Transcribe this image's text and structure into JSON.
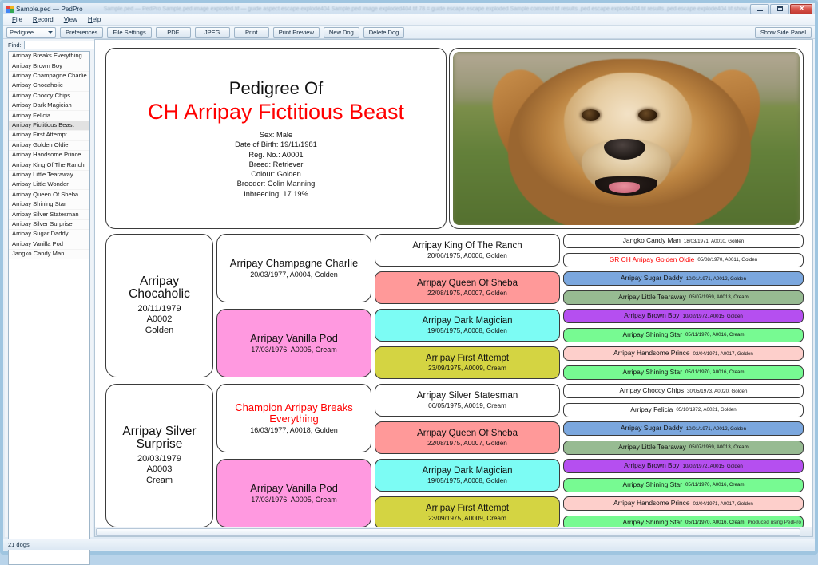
{
  "window": {
    "title": "Sample.ped — PedPro",
    "ghost_title": "Sample.ped — PedPro      Sample.ped image exploded.tif — guide aspect escape explode404      Sample.ped image exploded404 tif 78 = guide escape escape exploded      Sample comment      tif results .ped escape explode404      tif results .ped escape explode404      tif show escape escape ex",
    "minimize": "–",
    "maximize": "□",
    "close": "✕"
  },
  "menu": {
    "items": [
      "File",
      "Record",
      "View",
      "Help"
    ]
  },
  "toolbar": {
    "mode_combo": "Pedigree",
    "buttons": [
      "Preferences",
      "File Settings",
      "PDF",
      "JPEG",
      "Print",
      "Print Preview",
      "New Dog",
      "Delete Dog"
    ],
    "show_side_panel": "Show Side Panel"
  },
  "side_panel": {
    "find_label": "Find:",
    "find_value": "",
    "find_placeholder": "",
    "dogs": [
      {
        "name": "Arripay Breaks Everything",
        "selected": false
      },
      {
        "name": "Arripay Brown Boy",
        "selected": false
      },
      {
        "name": "Arripay Champagne Charlie",
        "selected": false
      },
      {
        "name": "Arripay Chocaholic",
        "selected": false
      },
      {
        "name": "Arripay Choccy Chips",
        "selected": false
      },
      {
        "name": "Arripay Dark Magician",
        "selected": false
      },
      {
        "name": "Arripay Felicia",
        "selected": false
      },
      {
        "name": "Arripay Fictitious Beast",
        "selected": true
      },
      {
        "name": "Arripay First Attempt",
        "selected": false
      },
      {
        "name": "Arripay Golden Oldie",
        "selected": false
      },
      {
        "name": "Arripay Handsome Prince",
        "selected": false
      },
      {
        "name": "Arripay King Of The Ranch",
        "selected": false
      },
      {
        "name": "Arripay Little Tearaway",
        "selected": false
      },
      {
        "name": "Arripay Little Wonder",
        "selected": false
      },
      {
        "name": "Arripay Queen Of Sheba",
        "selected": false
      },
      {
        "name": "Arripay Shining Star",
        "selected": false
      },
      {
        "name": "Arripay Silver Statesman",
        "selected": false
      },
      {
        "name": "Arripay Silver Surprise",
        "selected": false
      },
      {
        "name": "Arripay Sugar Daddy",
        "selected": false
      },
      {
        "name": "Arripay Vanilla Pod",
        "selected": false
      },
      {
        "name": "Jangko Candy Man",
        "selected": false
      }
    ]
  },
  "status_bar": {
    "text": "21 dogs"
  },
  "pedigree": {
    "heading": "Pedigree Of",
    "subject_name": "CH Arripay Fictitious Beast",
    "subject_name_color": "#ff0000",
    "details": [
      "Sex: Male",
      "Date of Birth: 19/11/1981",
      "Reg. No.: A0001",
      "Breed: Retriever",
      "Colour: Golden",
      "Breeder: Colin Manning",
      "Inbreeding: 17.19%"
    ],
    "photo_alt": "golden-retriever-photo",
    "footer": "Produced using PedPro",
    "generation1": [
      {
        "name_line1": "Arripay",
        "name_line2": "Chocaholic",
        "dob": "20/11/1979",
        "reg": "A0002",
        "colour": "Golden",
        "bg": "#ffffff",
        "champion": false
      },
      {
        "name_line1": "Arripay Silver",
        "name_line2": "Surprise",
        "dob": "20/03/1979",
        "reg": "A0003",
        "colour": "Cream",
        "bg": "#ffffff",
        "champion": false
      }
    ],
    "generation2": [
      {
        "name": "Arripay Champagne Charlie",
        "info": "20/03/1977, A0004, Golden",
        "bg": "#ffffff",
        "champion": false
      },
      {
        "name": "Arripay Vanilla Pod",
        "info": "17/03/1976, A0005, Cream",
        "bg": "#ff99e0",
        "champion": false
      },
      {
        "name": "Champion Arripay Breaks Everything",
        "info": "16/03/1977, A0018, Golden",
        "bg": "#ffffff",
        "champion": true
      },
      {
        "name": "Arripay Vanilla Pod",
        "info": "17/03/1976, A0005, Cream",
        "bg": "#ff99e0",
        "champion": false
      }
    ],
    "generation3": [
      {
        "name": "Arripay King Of The Ranch",
        "info": "20/06/1975, A0006, Golden",
        "bg": "#ffffff",
        "champion": false
      },
      {
        "name": "Arripay Queen Of Sheba",
        "info": "22/08/1975, A0007, Golden",
        "bg": "#ff9999",
        "champion": false
      },
      {
        "name": "Arripay Dark Magician",
        "info": "19/05/1975, A0008, Golden",
        "bg": "#7cfcf4",
        "champion": false
      },
      {
        "name": "Arripay First Attempt",
        "info": "23/09/1975, A0009, Cream",
        "bg": "#d4d442",
        "champion": false
      },
      {
        "name": "Arripay Silver Statesman",
        "info": "06/05/1975, A0019, Cream",
        "bg": "#ffffff",
        "champion": false
      },
      {
        "name": "Arripay Queen Of Sheba",
        "info": "22/08/1975, A0007, Golden",
        "bg": "#ff9999",
        "champion": false
      },
      {
        "name": "Arripay Dark Magician",
        "info": "19/05/1975, A0008, Golden",
        "bg": "#7cfcf4",
        "champion": false
      },
      {
        "name": "Arripay First Attempt",
        "info": "23/09/1975, A0009, Cream",
        "bg": "#d4d442",
        "champion": false
      }
    ],
    "generation4": [
      {
        "name": "Jangko Candy Man",
        "info": "18/03/1971, A0010, Golden",
        "bg": "#ffffff",
        "champion": false
      },
      {
        "name": "GR CH Arripay Golden Oldie",
        "info": "05/08/1970, A0011, Golden",
        "bg": "#ffffff",
        "champion": true
      },
      {
        "name": "Arripay Sugar Daddy",
        "info": "10/01/1971, A0012, Golden",
        "bg": "#7ba7de",
        "champion": false
      },
      {
        "name": "Arripay Little Tearaway",
        "info": "05/07/1969, A0013, Cream",
        "bg": "#97bb92",
        "champion": false
      },
      {
        "name": "Arripay Brown Boy",
        "info": "10/02/1972, A0015, Golden",
        "bg": "#b54ff0",
        "champion": false
      },
      {
        "name": "Arripay Shining Star",
        "info": "05/11/1970, A0016, Cream",
        "bg": "#77fa92",
        "champion": false
      },
      {
        "name": "Arripay Handsome Prince",
        "info": "02/04/1971, A0017, Golden",
        "bg": "#fdcfcb",
        "champion": false
      },
      {
        "name": "Arripay Shining Star",
        "info": "05/11/1970, A0016, Cream",
        "bg": "#77fa92",
        "champion": false
      },
      {
        "name": "Arripay Choccy Chips",
        "info": "30/05/1973, A0020, Golden",
        "bg": "#ffffff",
        "champion": false
      },
      {
        "name": "Arripay Felicia",
        "info": "05/10/1972, A0021, Golden",
        "bg": "#ffffff",
        "champion": false
      },
      {
        "name": "Arripay Sugar Daddy",
        "info": "10/01/1971, A0012, Golden",
        "bg": "#7ba7de",
        "champion": false
      },
      {
        "name": "Arripay Little Tearaway",
        "info": "05/07/1969, A0013, Cream",
        "bg": "#97bb92",
        "champion": false
      },
      {
        "name": "Arripay Brown Boy",
        "info": "10/02/1972, A0015, Golden",
        "bg": "#b54ff0",
        "champion": false
      },
      {
        "name": "Arripay Shining Star",
        "info": "05/11/1970, A0016, Cream",
        "bg": "#77fa92",
        "champion": false
      },
      {
        "name": "Arripay Handsome Prince",
        "info": "02/04/1971, A0017, Golden",
        "bg": "#fdcfcb",
        "champion": false
      },
      {
        "name": "Arripay Shining Star",
        "info": "05/11/1970, A0016, Cream",
        "bg": "#77fa92",
        "champion": false
      }
    ]
  }
}
